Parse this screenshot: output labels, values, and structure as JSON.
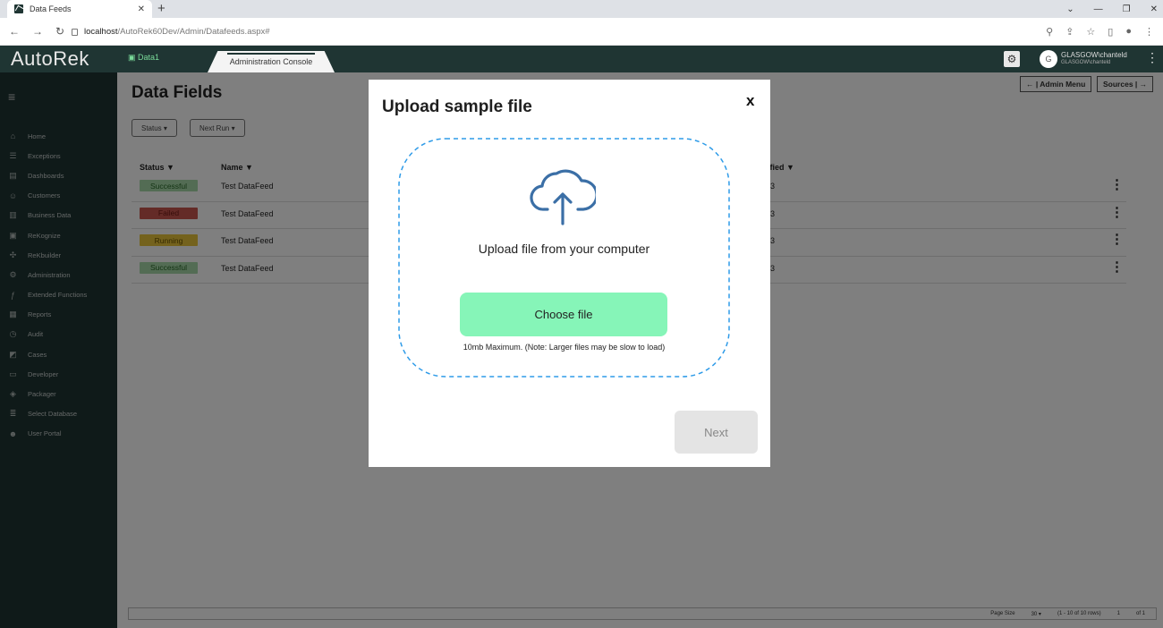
{
  "browser": {
    "tab_title": "Data Feeds",
    "tab_close": "✕",
    "new_tab": "+",
    "url_host": "localhost",
    "url_path": "/AutoRek60Dev/Admin/Datafeeds.aspx#"
  },
  "app": {
    "logo": "AutoRek",
    "database": "Data1",
    "console_tab": "Administration Console",
    "user_initial": "G",
    "user_name": "GLASGOW\\chanteld",
    "user_sub": "GLASGOW\\chanteld"
  },
  "sidebar": {
    "items": [
      {
        "label": "Home",
        "icon": "home-icon",
        "glyph": "⌂"
      },
      {
        "label": "Exceptions",
        "icon": "exceptions-icon",
        "glyph": "☰"
      },
      {
        "label": "Dashboards",
        "icon": "dashboards-icon",
        "glyph": "▤"
      },
      {
        "label": "Customers",
        "icon": "customers-icon",
        "glyph": "☺"
      },
      {
        "label": "Business Data",
        "icon": "business-data-icon",
        "glyph": "▥"
      },
      {
        "label": "ReKognize",
        "icon": "rekognize-icon",
        "glyph": "▣"
      },
      {
        "label": "ReKbuilder",
        "icon": "rekbuilder-icon",
        "glyph": "✣"
      },
      {
        "label": "Administration",
        "icon": "administration-icon",
        "glyph": "⚙"
      },
      {
        "label": "Extended Functions",
        "icon": "function-icon",
        "glyph": "ƒ"
      },
      {
        "label": "Reports",
        "icon": "reports-icon",
        "glyph": "▦"
      },
      {
        "label": "Audit",
        "icon": "audit-icon",
        "glyph": "◷"
      },
      {
        "label": "Cases",
        "icon": "cases-icon",
        "glyph": "◩"
      },
      {
        "label": "Developer",
        "icon": "developer-icon",
        "glyph": "▭"
      },
      {
        "label": "Packager",
        "icon": "packager-icon",
        "glyph": "◈"
      },
      {
        "label": "Select Database",
        "icon": "database-icon",
        "glyph": "≣"
      },
      {
        "label": "User Portal",
        "icon": "user-portal-icon",
        "glyph": "☻"
      }
    ]
  },
  "main": {
    "title": "Data Fields",
    "filters": {
      "status": "Status ▾",
      "next_run": "Next Run ▾"
    },
    "header_links": {
      "admin_menu": "← | Admin Menu",
      "sources": "Sources | →"
    },
    "columns": {
      "status": "Status ▼",
      "name": "Name ▼",
      "modified": "ified ▼"
    },
    "rows": [
      {
        "status": "Successful",
        "status_bg": "#a6d8a8",
        "status_fg": "#2a6a2a",
        "name": "Test DataFeed",
        "modified": "3"
      },
      {
        "status": "Failed",
        "status_bg": "#c9574e",
        "status_fg": "#6e1a14",
        "name": "Test DataFeed",
        "modified": "3"
      },
      {
        "status": "Running",
        "status_bg": "#e8c53a",
        "status_fg": "#6a5200",
        "name": "Test DataFeed",
        "modified": "3"
      },
      {
        "status": "Successful",
        "status_bg": "#a6d8a8",
        "status_fg": "#2a6a2a",
        "name": "Test DataFeed",
        "modified": "3"
      }
    ],
    "pager": {
      "page_size_label": "Page Size",
      "page_size_value": "30 ▾",
      "rows_info": "(1 - 10 of 10 rows)",
      "page_current": "1",
      "page_total": "of 1"
    }
  },
  "modal": {
    "title": "Upload sample file",
    "close": "x",
    "drop_text": "Upload file from your computer",
    "choose_button": "Choose file",
    "limit_note": "10mb Maximum. (Note: Larger files may be slow to load)",
    "next_button": "Next",
    "accent_color": "#2e9be8"
  }
}
